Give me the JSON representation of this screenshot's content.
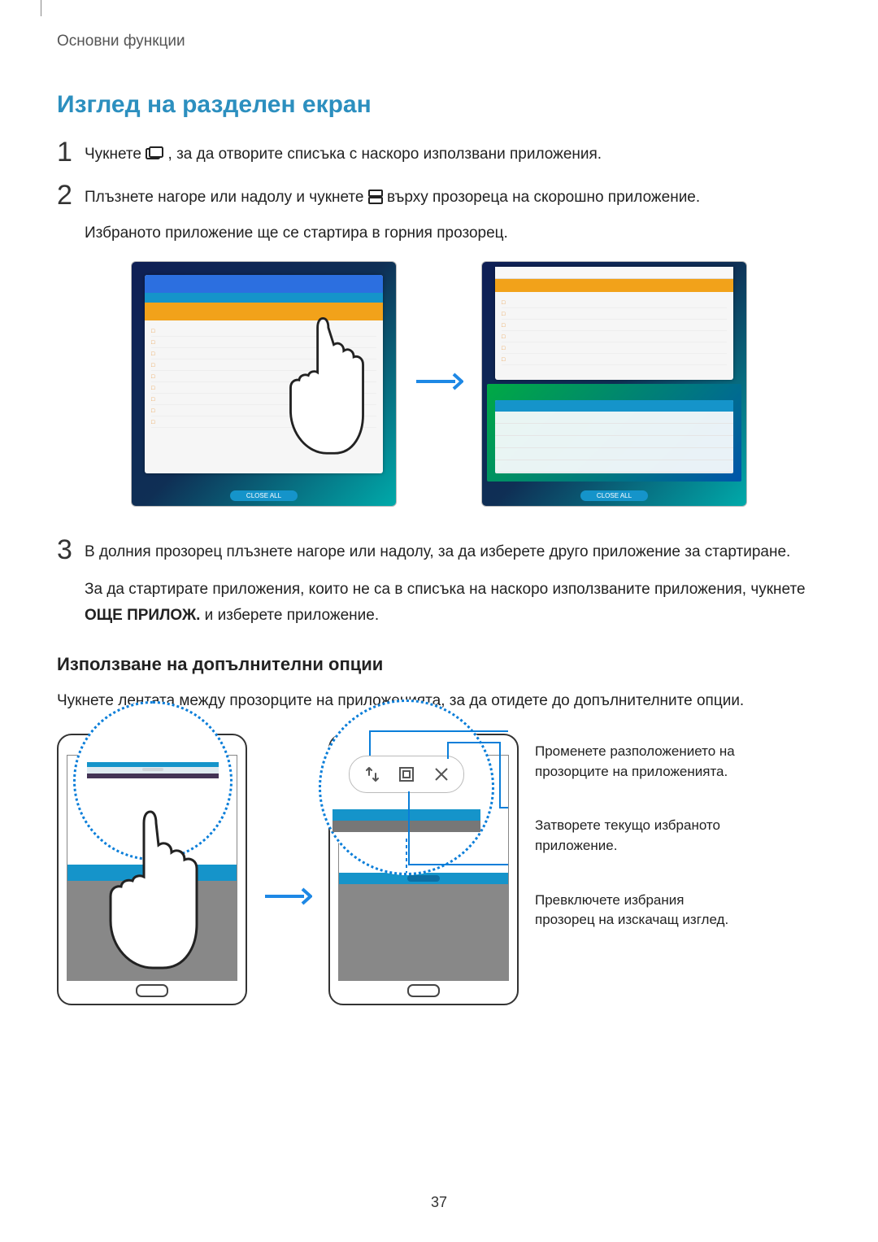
{
  "header": {
    "section": "Основни функции"
  },
  "title": "Изглед на разделен екран",
  "steps": {
    "s1": {
      "num": "1",
      "before": "Чукнете ",
      "after": ", за да отворите списъка с наскоро използвани приложения."
    },
    "s2": {
      "num": "2",
      "before": "Плъзнете нагоре или надолу и чукнете ",
      "after": " върху прозореца на скорошно приложение.",
      "line2": "Избраното приложение ще се стартира в горния прозорец."
    },
    "s3": {
      "num": "3",
      "line1": "В долния прозорец плъзнете нагоре или надолу, за да изберете друго приложение за стартиране.",
      "line2_a": "За да стартирате приложения, които не са в списъка на наскоро използваните приложения, чукнете ",
      "line2_bold": "ОЩЕ ПРИЛОЖ.",
      "line2_b": " и изберете приложение."
    }
  },
  "subheading": "Използване на допълнителни опции",
  "subtext": "Чукнете лентата между прозорците на приложенията, за да отидете до допълнителните опции.",
  "annotations": {
    "swap": "Променете разположението на прозорците на приложенията.",
    "close": "Затворете текущо избраното приложение.",
    "popup": "Превключете избрания прозорец на изскачащ изглед."
  },
  "pageNumber": "37",
  "icons": {
    "recent": "recent-apps-icon",
    "split": "split-screen-icon",
    "swap": "swap-icon",
    "popup": "popup-icon",
    "close": "close-icon"
  }
}
